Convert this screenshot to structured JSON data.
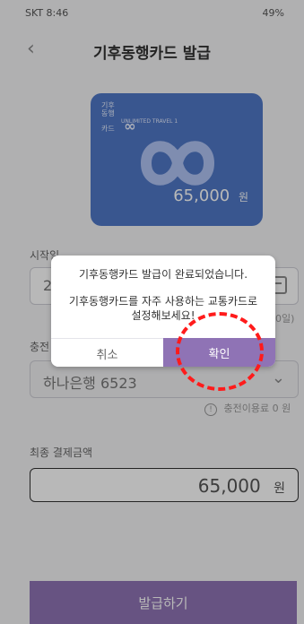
{
  "status_bar": {
    "time": "SKT 8:46",
    "right": "49%"
  },
  "header": {
    "title": "기후동행카드 발급"
  },
  "card": {
    "amount": "65,000",
    "currency": "원",
    "brand_prefix": "기후\n동행\n카드",
    "sub_text": "UNLIMITED TRAVEL 1"
  },
  "form": {
    "start_label": "시작일",
    "start_value_visible": "2",
    "extra_right_hint": "0일)",
    "charge_label": "충전",
    "bank_value": "하나은행 6523",
    "fee_text": "충전이용료 0 원"
  },
  "total": {
    "label": "최종 결제금액",
    "amount": "65,000",
    "unit": "원"
  },
  "footer": {
    "issue_label": "발급하기"
  },
  "dialog": {
    "message_1": "기후동행카드 발급이 완료되었습니다.",
    "message_2": "기후동행카드를 자주 사용하는 교통카드로",
    "message_3": "설정해보세요!",
    "cancel_label": "취소",
    "confirm_label": "확인"
  },
  "colors": {
    "accent": "#8f73b5",
    "card": "#4f78c7",
    "highlight": "#ff1b1b"
  }
}
